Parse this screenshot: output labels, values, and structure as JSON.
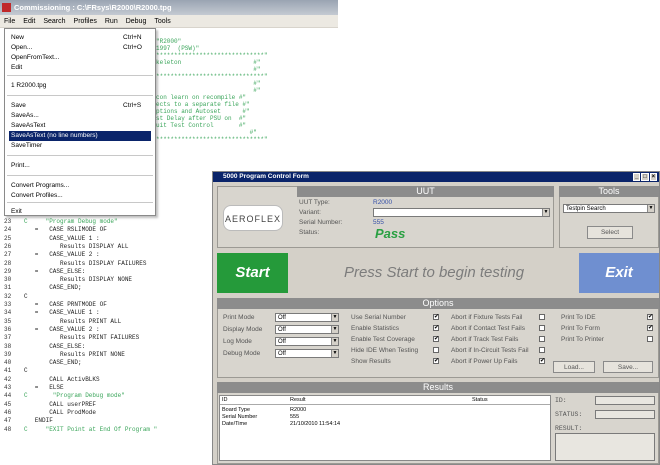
{
  "bg": {
    "title": "Commissioning : C:\\FRsys\\R2000\\R2000.tpg",
    "menu": [
      "File",
      "Edit",
      "Search",
      "Profiles",
      "Run",
      "Debug",
      "Tools"
    ]
  },
  "file_menu": {
    "items": [
      {
        "label": "New",
        "shortcut": "Ctrl+N"
      },
      {
        "label": "Open...",
        "shortcut": "Ctrl+O"
      },
      {
        "label": "OpenFromText...",
        "shortcut": ""
      },
      {
        "label": "Edit",
        "shortcut": ""
      },
      {
        "label": "1 R2000.tpg",
        "shortcut": ""
      },
      {
        "label": "Save",
        "shortcut": "Ctrl+S"
      },
      {
        "label": "SaveAs...",
        "shortcut": ""
      },
      {
        "label": "SaveAsText",
        "shortcut": ""
      },
      {
        "label": "SaveAsText (no line numbers)",
        "shortcut": ""
      },
      {
        "label": "SaveTimer",
        "shortcut": ""
      },
      {
        "label": "Print...",
        "shortcut": ""
      },
      {
        "label": "Convert Programs...",
        "shortcut": ""
      },
      {
        "label": "Convert Profiles...",
        "shortcut": ""
      },
      {
        "label": "Exit",
        "shortcut": ""
      }
    ]
  },
  "code_top": [
    "\"R2000\"",
    "1997  (PSW)\"",
    "******************************\"",
    "keleton                    #\"",
    "                           #\"",
    "******************************\"",
    "                           #\"",
    "                           #\"",
    "con learn on recompile #\"",
    "ects to a separate file #\"",
    "ptions and Autoset      #\"",
    "st Delay after PSU on  #\"",
    "uit Test Control       #\"",
    "                          #\"",
    "******************************\""
  ],
  "code_bottom": [
    {
      "n": "23",
      "t": "C     \"Program Debug mode\""
    },
    {
      "n": "24",
      "t": "   =   CASE RSLIMODE OF"
    },
    {
      "n": "25",
      "t": "       CASE_VALUE 1 :"
    },
    {
      "n": "26",
      "t": "          Results DISPLAY ALL"
    },
    {
      "n": "27",
      "t": "   =   CASE_VALUE 2 :"
    },
    {
      "n": "28",
      "t": "          Results DISPLAY FAILURES"
    },
    {
      "n": "29",
      "t": "   =   CASE_ELSE:"
    },
    {
      "n": "30",
      "t": "          Results DISPLAY NONE"
    },
    {
      "n": "31",
      "t": "       CASE_END;"
    },
    {
      "n": "32",
      "t": "C"
    },
    {
      "n": "33",
      "t": "   =   CASE PRNTMODE OF"
    },
    {
      "n": "34",
      "t": "   =   CASE_VALUE 1 :"
    },
    {
      "n": "35",
      "t": "          Results PRINT ALL"
    },
    {
      "n": "36",
      "t": "   =   CASE_VALUE 2 :"
    },
    {
      "n": "37",
      "t": "          Results PRINT FAILURES"
    },
    {
      "n": "38",
      "t": "       CASE_ELSE:"
    },
    {
      "n": "39",
      "t": "          Results PRINT NONE"
    },
    {
      "n": "40",
      "t": "       CASE_END;"
    },
    {
      "n": "41",
      "t": "C"
    },
    {
      "n": "42",
      "t": "       CALL ActivBLKS"
    },
    {
      "n": "43",
      "t": "   =   ELSE"
    },
    {
      "n": "44",
      "t": "C       \"Program Debug mode\""
    },
    {
      "n": "45",
      "t": "       CALL userPREF"
    },
    {
      "n": "46",
      "t": "       CALL ProdMode"
    },
    {
      "n": "47",
      "t": "   ENDIF"
    },
    {
      "n": "48",
      "t": "C     \"EXIT Point at End Of Program \""
    }
  ],
  "panel": {
    "title": "5000 Program Control Form",
    "uut_header": "UUT",
    "tools_header": "Tools",
    "logo": "AEROFLEX",
    "uut_type_label": "UUT Type:",
    "uut_type_value": "R2000",
    "variant_label": "Variant:",
    "serial_label": "Serial Number:",
    "serial_value": "555",
    "status_label": "Status:",
    "status_value": "Pass",
    "tools_select": "Testpin Search",
    "select_button": "Select",
    "start_button": "Start",
    "prompt": "Press Start to begin testing",
    "exit_button": "Exit",
    "options_header": "Options",
    "modes": [
      {
        "label": "Print Mode",
        "value": "Off"
      },
      {
        "label": "Display Mode",
        "value": "Off"
      },
      {
        "label": "Log Mode",
        "value": "Off"
      },
      {
        "label": "Debug Mode",
        "value": "Off"
      }
    ],
    "col2": [
      {
        "label": "Use Serial Number",
        "checked": true
      },
      {
        "label": "Enable Statistics",
        "checked": true
      },
      {
        "label": "Enable Test Coverage",
        "checked": true
      },
      {
        "label": "Hide IDE When Testing",
        "checked": false
      },
      {
        "label": "Show Results",
        "checked": true
      }
    ],
    "col3": [
      {
        "label": "Abort if Fixture Tests Fail",
        "checked": false
      },
      {
        "label": "Abort if Contact Test Fails",
        "checked": false
      },
      {
        "label": "Abort if Track Test Fails",
        "checked": false
      },
      {
        "label": "Abort if In-Circuit Tests Fail",
        "checked": false
      },
      {
        "label": "Abort if Power Up Fails",
        "checked": true
      }
    ],
    "col4": [
      {
        "label": "Print To IDE",
        "checked": true
      },
      {
        "label": "Print To Form",
        "checked": true
      },
      {
        "label": "Print To Printer",
        "checked": false
      }
    ],
    "load_button": "Load...",
    "save_button": "Save...",
    "results_header": "Results",
    "results_cols": [
      "ID",
      "Result",
      "Status"
    ],
    "results_rows": [
      [
        "Board Type",
        "R2000",
        ""
      ],
      [
        "Serial Number",
        "555",
        ""
      ],
      [
        "Date/Time",
        "21/10/2010 11:54:14",
        ""
      ]
    ],
    "side_labels": [
      "ID:",
      "STATUS:",
      "RESULT:"
    ]
  }
}
